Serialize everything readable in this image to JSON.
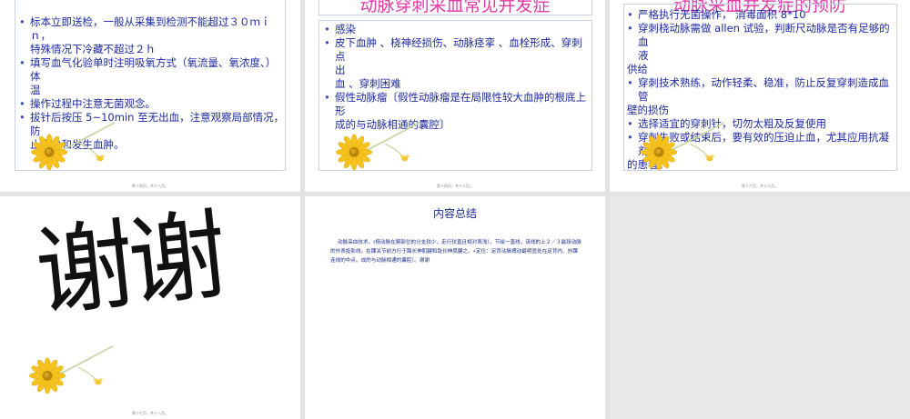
{
  "slides": [
    {
      "bullets": [
        {
          "lines": [
            "标本立即送检，一般从采集到检测不能超过３０ｍｉｎ，",
            "特殊情况下冷藏不超过２ｈ"
          ]
        },
        {
          "lines": [
            "填写血气化验单时注明吸氧方式（氧流量、氧浓度、）体",
            "温"
          ]
        },
        {
          "lines": [
            "操作过程中注意无菌观念。"
          ]
        },
        {
          "lines": [
            "拔针后按压 5~10min 至无出血，注意观察局部情况，防",
            "止出血和发生血肿。"
          ]
        }
      ]
    },
    {
      "title": "动脉穿刺采血常见并发症",
      "bullets": [
        {
          "lines": [
            "感染"
          ]
        },
        {
          "lines": [
            "皮下血肿 、桡神经损伤、动脉痉挛 、血栓形成、穿刺点",
            "出",
            "血 、穿刺困难"
          ]
        },
        {
          "lines": [
            "假性动脉瘤〔假性动脉瘤是在局限性较大血肿的根底上形",
            "成的与动脉相通的囊腔〕"
          ]
        }
      ],
      "footer": "第十四页，共十八页。"
    },
    {
      "title": "动脉采血并发症的预防",
      "bullets": [
        {
          "lines": [
            "严格执行无菌操作， 消毒面积 8*10"
          ]
        },
        {
          "lines": [
            "穿刺桡动脉需做 allen 试验，判断尺动脉是否有足够的血",
            "液",
            "供给"
          ]
        },
        {
          "lines": [
            "穿刺技术熟练，动作轻柔、稳准，防止反复穿刺造成血管",
            "壁的损伤"
          ]
        },
        {
          "lines": [
            "选择适宜的穿刺针，切勿太粗及反复使用"
          ]
        },
        {
          "lines": [
            "穿刺失败或结束后，要有效的压迫止血，尤其应用抗凝剂",
            "的患者。"
          ]
        }
      ],
      "footer": "第十六页，共十八页。"
    },
    {
      "thanks": "谢谢",
      "footer": "第十七页，共十八页。"
    },
    {
      "title": "内容总结",
      "body": "动脉采血技术。(桡动脉在腕部位的分支较少，走行较直且相对表浅）。节绘一直线，该线的上２／３最段动脉的外表投影线。在踝关节前方行于踇长伸肌腱和趾长伸肌腱之。•定位：足背动脉搏动最明显处在足背内、外踝连线的中点。成的与动脉相通的囊腔〕。谢谢"
    }
  ],
  "slide1_footer": "第十四页，共十八页。",
  "colors": {
    "bullet_text": "#1e2aa0",
    "title_pink": "#e23aa5",
    "summary_text": "#1a2a8c",
    "background": "#e3e3e3"
  },
  "icons": [
    "daisy-flower-illustration"
  ]
}
